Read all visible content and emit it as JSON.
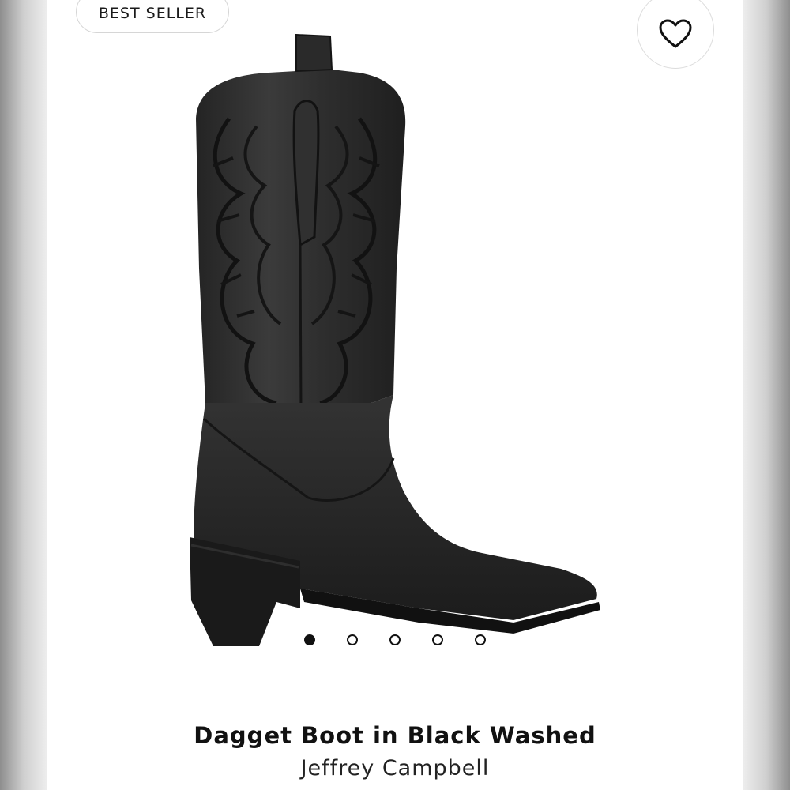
{
  "product": {
    "badge": "BEST SELLER",
    "name": "Dagget Boot in Black Washed",
    "brand": "Jeffrey Campbell",
    "wishlist_icon": "heart-outline-icon",
    "image": {
      "subject": "black western cowboy boot with embroidered shaft",
      "colors": {
        "leather": "#2b2b2b",
        "leather_highlight": "#4a4a4a",
        "stitching": "#141414",
        "sole": "#1a1a1a"
      }
    },
    "carousel": {
      "total": 5,
      "active_index": 0
    }
  }
}
